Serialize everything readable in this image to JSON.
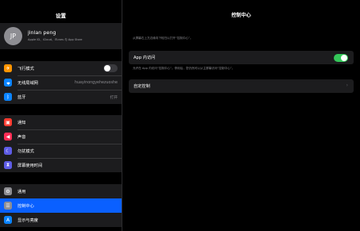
{
  "status": {
    "time": "20:49  4月11日周二",
    "battery": "88%"
  },
  "sidebar": {
    "title": "设置",
    "profile": {
      "initials": "JP",
      "name": "jinlan peng",
      "subtitle": "Apple ID、iCloud、iTunes 与 App Store"
    },
    "group1": [
      {
        "label": "飞行模式",
        "icon": "airplane-icon",
        "color": "#ff9500",
        "toggle": false
      },
      {
        "label": "无线局域网",
        "icon": "wifi-icon",
        "color": "#0a84ff",
        "value": "huayinongyehezuoshe"
      },
      {
        "label": "蓝牙",
        "icon": "bluetooth-icon",
        "color": "#0a84ff",
        "value": "打开"
      }
    ],
    "group2": [
      {
        "label": "通知",
        "icon": "notification-icon",
        "color": "#ff3b30"
      },
      {
        "label": "声音",
        "icon": "sound-icon",
        "color": "#ff2d55"
      },
      {
        "label": "勿扰模式",
        "icon": "moon-icon",
        "color": "#5e5ce6"
      },
      {
        "label": "屏幕使用时间",
        "icon": "hourglass-icon",
        "color": "#5e5ce6"
      }
    ],
    "group3": [
      {
        "label": "通用",
        "icon": "gear-icon",
        "color": "#8e8e93"
      },
      {
        "label": "控制中心",
        "icon": "control-center-icon",
        "color": "#8e8e93",
        "selected": true
      },
      {
        "label": "显示与亮度",
        "icon": "display-icon",
        "color": "#0a84ff"
      }
    ]
  },
  "main": {
    "title": "控制中心",
    "top_hint": "从屏幕右上方边缘向下轻扫以打开“控制中心”。",
    "app_access_label": "App 内访问",
    "app_access_on": true,
    "app_access_hint": "允许在 App 内访问“控制中心”。停用后，您仍然可以从主屏幕访问“控制中心”。",
    "customize_label": "自定控制",
    "chevron": "›"
  }
}
